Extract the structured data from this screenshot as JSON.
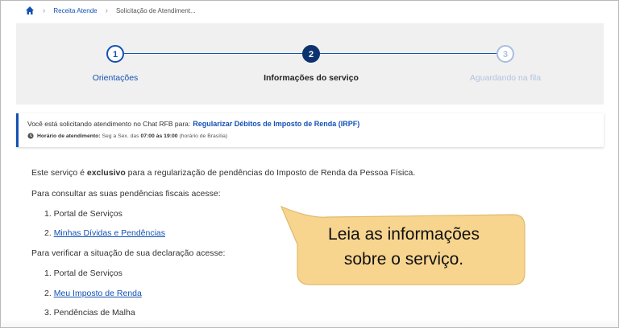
{
  "breadcrumb": {
    "items": [
      "Receita Atende",
      "Solicitação de Atendiment..."
    ]
  },
  "stepper": {
    "steps": [
      {
        "number": "1",
        "label": "Orientações",
        "state": "done"
      },
      {
        "number": "2",
        "label": "Informações do serviço",
        "state": "current"
      },
      {
        "number": "3",
        "label": "Aguardando na fila",
        "state": "pending"
      }
    ]
  },
  "info": {
    "prefix": "Você está solicitando atendimento no Chat RFB para:",
    "service": "Regularizar Débitos de Imposto de Renda (IRPF)",
    "hours_label": "Horário de atendimento:",
    "hours_text_a": "Seg a Sex. das",
    "hours_from": "07:00 às 19:00",
    "hours_tz": "(horário de Brasília)"
  },
  "content": {
    "intro_a": "Este serviço é",
    "intro_bold": "exclusivo",
    "intro_b": "para a regularização de pendências do Imposto de Renda da Pessoa Física.",
    "consult_heading": "Para consultar as suas pendências fiscais acesse:",
    "consult_items": [
      "1. Portal de Serviços",
      "2.",
      "Minhas Dívidas e Pendências"
    ],
    "verify_heading": "Para verificar a situação de sua declaração acesse:",
    "verify_items": [
      "1. Portal de Serviços",
      "2.",
      "Meu Imposto de Renda",
      "3. Pendências de Malha"
    ]
  },
  "callout": {
    "line1": "Leia as informações",
    "line2": "sobre o serviço."
  },
  "colors": {
    "primary": "#1351b4",
    "current_step": "#0c326f",
    "callout_fill": "#f7d58f"
  }
}
